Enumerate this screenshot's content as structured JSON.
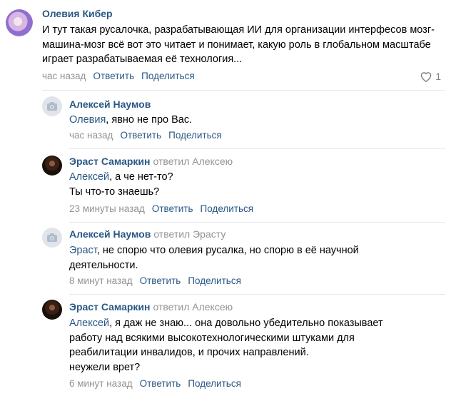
{
  "top": {
    "author": "Олевия Кибер",
    "text": "И тут такая русалочка, разрабатывающая ИИ для организации интерфесов мозг-машина-мозг всё вот это читает и понимает, какую роль в глобальном масштабе играет разрабатываемая её технология...",
    "time": "час назад",
    "reply": "Ответить",
    "share": "Поделиться",
    "likes": "1"
  },
  "replies": [
    {
      "author": "Алексей Наумов",
      "replied_to": "",
      "mention": "Олевия",
      "text": ", явно не про Вас.",
      "time": "час назад",
      "reply": "Ответить",
      "share": "Поделиться"
    },
    {
      "author": "Эраст Самаркин",
      "replied_to": "ответил Алексею",
      "mention": "Алексей",
      "text": ", а че нет-то?",
      "text2": "Ты что-то знаешь?",
      "time": "23 минуты назад",
      "reply": "Ответить",
      "share": "Поделиться"
    },
    {
      "author": "Алексей Наумов",
      "replied_to": "ответил Эрасту",
      "mention": "Эраст",
      "text": ", не спорю что олевия русалка, но спорю в её научной деятельности.",
      "time": "8 минут назад",
      "reply": "Ответить",
      "share": "Поделиться"
    },
    {
      "author": "Эраст Самаркин",
      "replied_to": "ответил Алексею",
      "mention": "Алексей",
      "text": ", я даж не знаю... она довольно убедительно показывает работу над всякими высокотехнологическими штуками для реабилитации инвалидов, и прочих направлений.",
      "text2": "неужели врет?",
      "time": "6 минут назад",
      "reply": "Ответить",
      "share": "Поделиться"
    }
  ],
  "colors": {
    "link": "#2a5885",
    "meta": "#939393",
    "divider": "#e7e8ec"
  },
  "icons": {
    "like": "heart-icon",
    "camera": "camera-icon"
  }
}
